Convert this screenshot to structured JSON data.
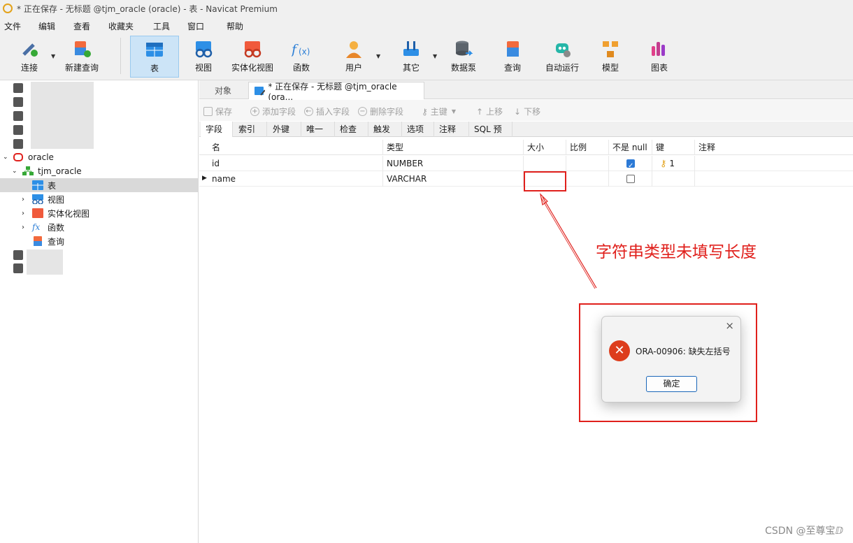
{
  "window": {
    "title": "* 正在保存 - 无标题 @tjm_oracle (oracle) - 表 - Navicat Premium"
  },
  "menu": [
    "文件",
    "编辑",
    "查看",
    "收藏夹",
    "工具",
    "窗口",
    "帮助"
  ],
  "toolbar": {
    "items": [
      "连接",
      "新建查询",
      "表",
      "视图",
      "实体化视图",
      "函数",
      "用户",
      "其它",
      "数据泵",
      "查询",
      "自动运行",
      "模型",
      "图表"
    ],
    "active": "表"
  },
  "sidebar": {
    "oracle": "oracle",
    "schema": "tjm_oracle",
    "children": [
      "表",
      "视图",
      "实体化视图",
      "函数",
      "查询"
    ]
  },
  "tabs": {
    "objects": "对象",
    "current": "* 正在保存 - 无标题 @tjm_oracle (ora..."
  },
  "editor_toolbar": [
    "保存",
    "添加字段",
    "插入字段",
    "删除字段",
    "主键",
    "上移",
    "下移"
  ],
  "subtabs": [
    "字段",
    "索引",
    "外键",
    "唯一键",
    "检查",
    "触发器",
    "选项",
    "注释",
    "SQL 预览"
  ],
  "grid": {
    "headers": [
      "名",
      "类型",
      "大小",
      "比例",
      "不是 null",
      "键",
      "注释"
    ],
    "rows": [
      {
        "name": "id",
        "type": "NUMBER",
        "size": "",
        "scale": "",
        "not_null": true,
        "key": "1"
      },
      {
        "name": "name",
        "type": "VARCHAR",
        "size": "",
        "scale": "",
        "not_null": false,
        "key": ""
      }
    ]
  },
  "annotation": {
    "text": "字符串类型未填写长度",
    "color": "#e0201c"
  },
  "dialog": {
    "message": "ORA-00906: 缺失左括号",
    "ok": "确定",
    "close": "×",
    "error_icon": "✕"
  },
  "watermark": "CSDN @至尊宝ⅅ"
}
